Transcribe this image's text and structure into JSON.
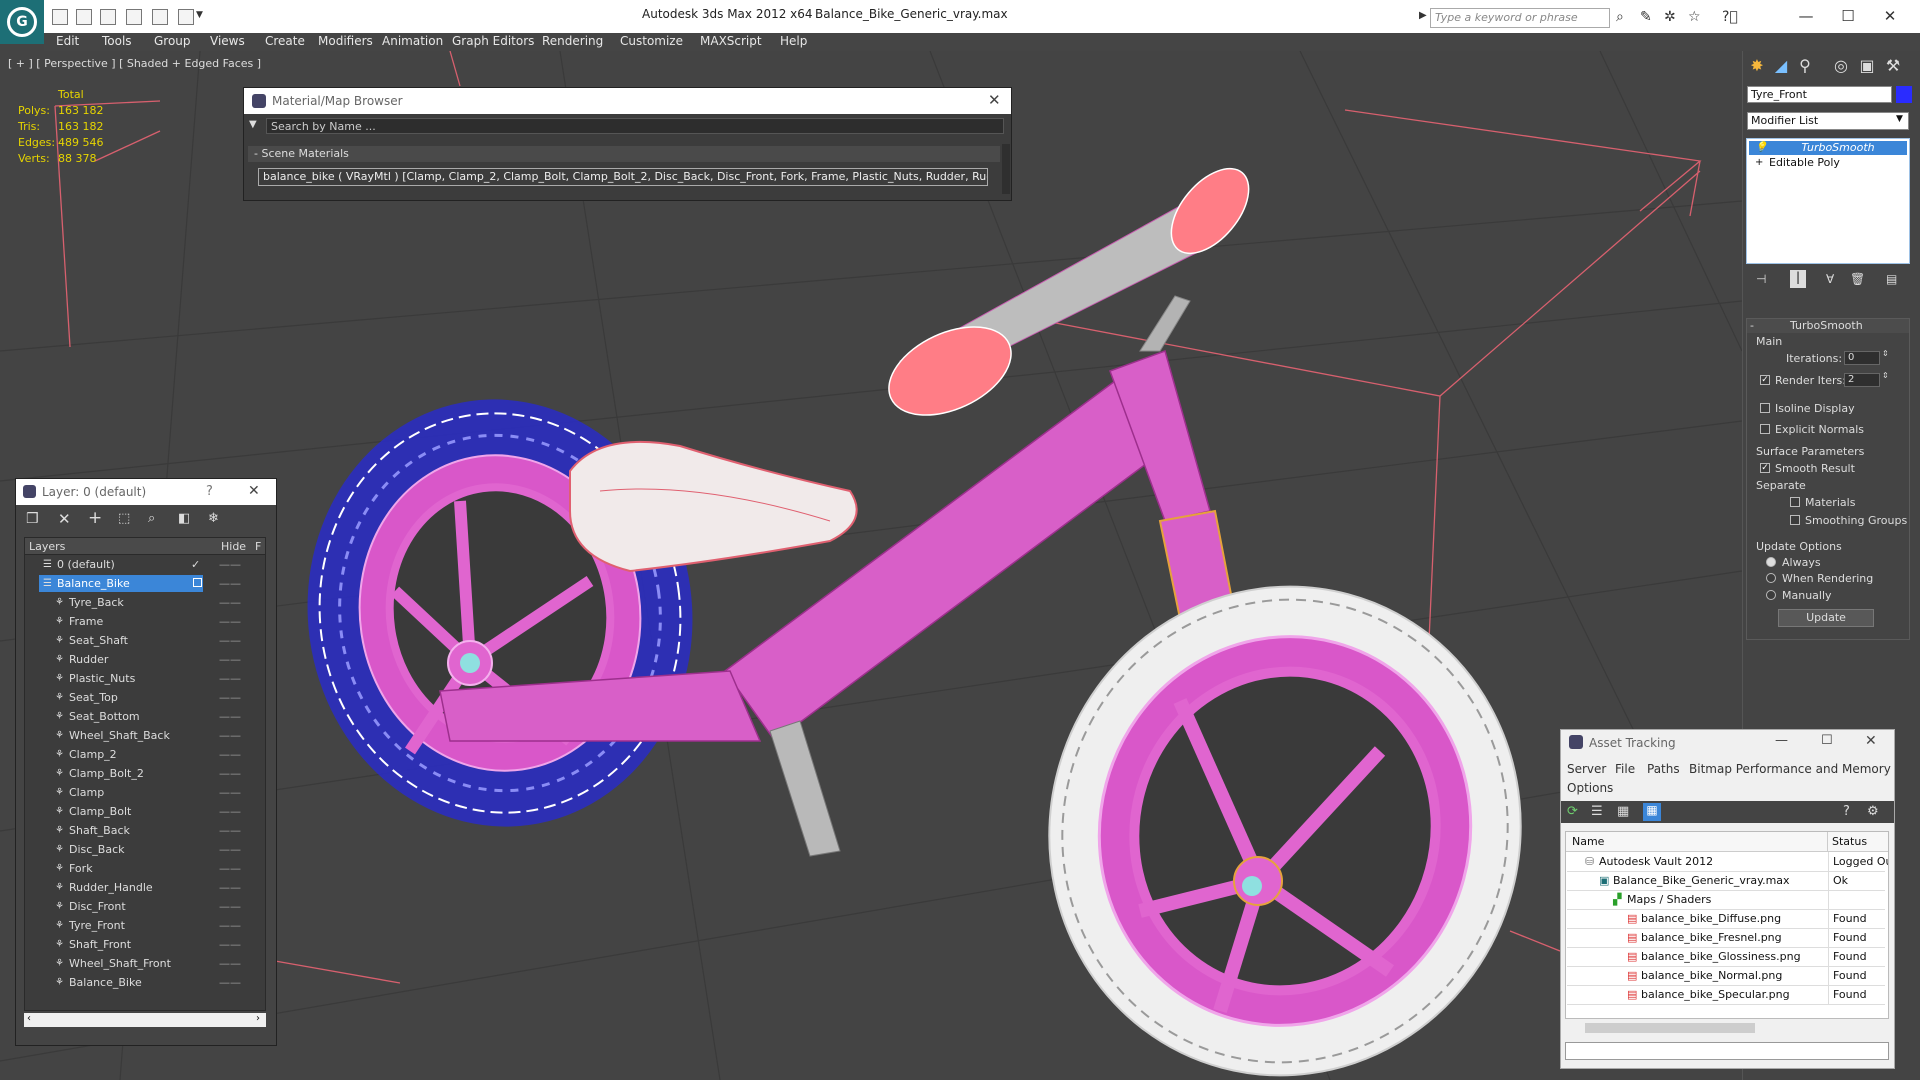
{
  "window": {
    "title": "Autodesk 3ds Max  2012 x64",
    "file": "Balance_Bike_Generic_vray.max",
    "search_placeholder": "Type a keyword or phrase",
    "app_logo_glyph": "G"
  },
  "menu": [
    "Edit",
    "Tools",
    "Group",
    "Views",
    "Create",
    "Modifiers",
    "Animation",
    "Graph Editors",
    "Rendering",
    "Customize",
    "MAXScript",
    "Help"
  ],
  "viewport": {
    "label": "[ + ] [ Perspective ] [ Shaded + Edged Faces ]",
    "stats": {
      "header": "Total",
      "rows": [
        {
          "label": "Polys:",
          "value": "163 182"
        },
        {
          "label": "Tris:",
          "value": "163 182"
        },
        {
          "label": "Edges:",
          "value": "489 546"
        },
        {
          "label": "Verts:",
          "value": "88 378"
        }
      ]
    }
  },
  "material_browser": {
    "title": "Material/Map Browser",
    "search_placeholder": "Search by Name ...",
    "section": "- Scene Materials",
    "entry": "balance_bike  ( VRayMtl )  [Clamp, Clamp_2, Clamp_Bolt, Clamp_Bolt_2, Disc_Back, Disc_Front, Fork, Frame, Plastic_Nuts, Rudder, Rudder_H..."
  },
  "layer_window": {
    "title": "Layer: 0 (default)",
    "help": "?",
    "col_layers": "Layers",
    "col_hide": "Hide",
    "col_freeze": "F",
    "rows": [
      {
        "name": "0 (default)",
        "level": 0,
        "active": false,
        "check": true
      },
      {
        "name": "Balance_Bike",
        "level": 0,
        "active": true,
        "check": false
      },
      {
        "name": "Tyre_Back",
        "level": 1
      },
      {
        "name": "Frame",
        "level": 1
      },
      {
        "name": "Seat_Shaft",
        "level": 1
      },
      {
        "name": "Rudder",
        "level": 1
      },
      {
        "name": "Plastic_Nuts",
        "level": 1
      },
      {
        "name": "Seat_Top",
        "level": 1
      },
      {
        "name": "Seat_Bottom",
        "level": 1
      },
      {
        "name": "Wheel_Shaft_Back",
        "level": 1
      },
      {
        "name": "Clamp_2",
        "level": 1
      },
      {
        "name": "Clamp_Bolt_2",
        "level": 1
      },
      {
        "name": "Clamp",
        "level": 1
      },
      {
        "name": "Clamp_Bolt",
        "level": 1
      },
      {
        "name": "Shaft_Back",
        "level": 1
      },
      {
        "name": "Disc_Back",
        "level": 1
      },
      {
        "name": "Fork",
        "level": 1
      },
      {
        "name": "Rudder_Handle",
        "level": 1
      },
      {
        "name": "Disc_Front",
        "level": 1
      },
      {
        "name": "Tyre_Front",
        "level": 1
      },
      {
        "name": "Shaft_Front",
        "level": 1
      },
      {
        "name": "Wheel_Shaft_Front",
        "level": 1
      },
      {
        "name": "Balance_Bike",
        "level": 1
      }
    ]
  },
  "command_panel": {
    "object_name": "Tyre_Front",
    "object_color": "#2a2cff",
    "modifier_list": "Modifier List",
    "stack": [
      {
        "name": "TurboSmooth",
        "selected": true
      },
      {
        "name": "Editable Poly",
        "selected": false
      }
    ],
    "rollout_title": "TurboSmooth",
    "main_label": "Main",
    "iterations_label": "Iterations:",
    "iterations_value": "0",
    "render_iters_label": "Render Iters:",
    "render_iters_value": "2",
    "isoline_label": "Isoline Display",
    "explicit_normals_label": "Explicit Normals",
    "surface_params_label": "Surface Parameters",
    "smooth_result_label": "Smooth Result",
    "separate_label": "Separate",
    "materials_label": "Materials",
    "smoothing_groups_label": "Smoothing Groups",
    "update_options_label": "Update Options",
    "always_label": "Always",
    "when_rendering_label": "When Rendering",
    "manually_label": "Manually",
    "update_button": "Update"
  },
  "asset_tracking": {
    "title": "Asset Tracking",
    "menu": [
      "Server",
      "File",
      "Paths",
      "Bitmap Performance and Memory",
      "Options"
    ],
    "col_name": "Name",
    "col_status": "Status",
    "rows": [
      {
        "name": "Autodesk Vault 2012",
        "status": "Logged Ou",
        "indent": 0,
        "icon": "vault-icon"
      },
      {
        "name": "Balance_Bike_Generic_vray.max",
        "status": "Ok",
        "indent": 1,
        "icon": "max-file-icon"
      },
      {
        "name": "Maps / Shaders",
        "status": "",
        "indent": 2,
        "icon": "maps-icon"
      },
      {
        "name": "balance_bike_Diffuse.png",
        "status": "Found",
        "indent": 3,
        "icon": "png-icon"
      },
      {
        "name": "balance_bike_Fresnel.png",
        "status": "Found",
        "indent": 3,
        "icon": "png-icon"
      },
      {
        "name": "balance_bike_Glossiness.png",
        "status": "Found",
        "indent": 3,
        "icon": "png-icon"
      },
      {
        "name": "balance_bike_Normal.png",
        "status": "Found",
        "indent": 3,
        "icon": "png-icon"
      },
      {
        "name": "balance_bike_Specular.png",
        "status": "Found",
        "indent": 3,
        "icon": "png-icon"
      }
    ]
  },
  "colors": {
    "viewport_bg": "#444444",
    "stats": "#e6d400",
    "frame_pink": "#e065cf",
    "tyre_back": "#1d20b8",
    "tyre_front": "#ffffff",
    "selection": "#3b86d8"
  }
}
